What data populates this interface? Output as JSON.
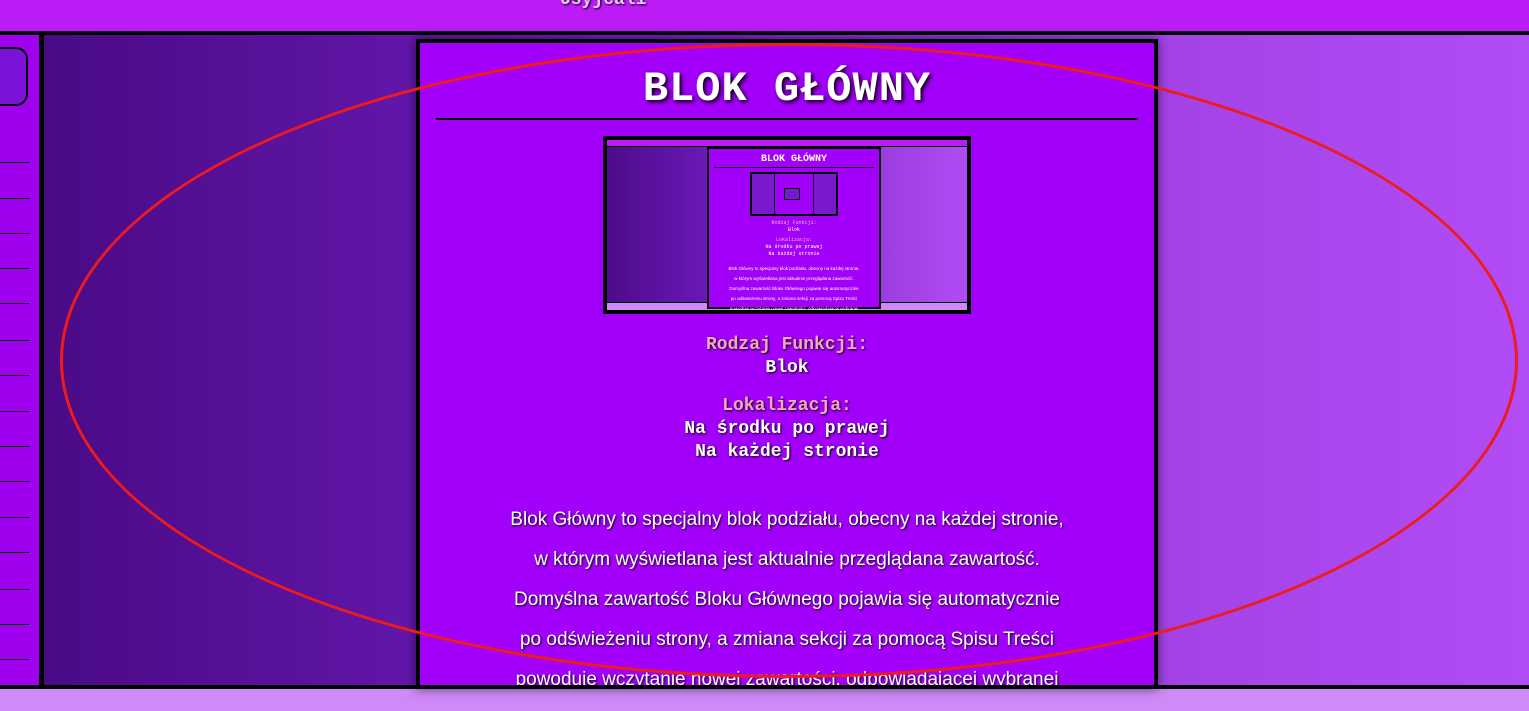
{
  "topbar": {
    "label": "Usyjcali"
  },
  "main_block": {
    "title": "BLOK GŁÓWNY",
    "function_label": "Rodzaj Funkcji:",
    "function_value": "Blok",
    "location_label": "Lokalizacja:",
    "location_lines": [
      "Na środku po prawej",
      "Na każdej stronie"
    ],
    "description_lines": [
      "Blok Główny to specjalny blok podziału, obecny na każdej stronie,",
      "w którym wyświetlana jest aktualnie przeglądana zawartość.",
      "Domyślna zawartość Bloku Głównego pojawia się automatycznie",
      "po odświeżeniu strony, a zmiana sekcji za pomocą Spisu Treści",
      "powoduje wczytanie nowej zawartości, odpowiadającej wybranej"
    ]
  },
  "thumbnail": {
    "title": "BLOK GŁÓWNY",
    "function_label": "Rodzaj Funkcji:",
    "function_value": "Blok",
    "location_label": "Lokalizacja:",
    "location_lines": [
      "Na środku po prawej",
      "Na każdej stronie"
    ],
    "description_lines": [
      "Blok Główny to specjalny blok podziału, obecny na każdej stronie,",
      "w którym wyświetlana jest aktualnie przeglądana zawartość.",
      "Domyślna zawartość Bloku Głównego pojawia się automatycznie",
      "po odświeżeniu strony, a zmiana sekcji za pomocą Spisu Treści",
      "powoduje wczytanie nowej zawartości, odpowiadającej wybranej"
    ]
  },
  "colors": {
    "topbar": "#bb1cf6",
    "main_block": "#a300fb",
    "label_pink": "#f6a7bf",
    "annotation": "#ee1b1b",
    "page_bottom": "#cf8af7"
  }
}
